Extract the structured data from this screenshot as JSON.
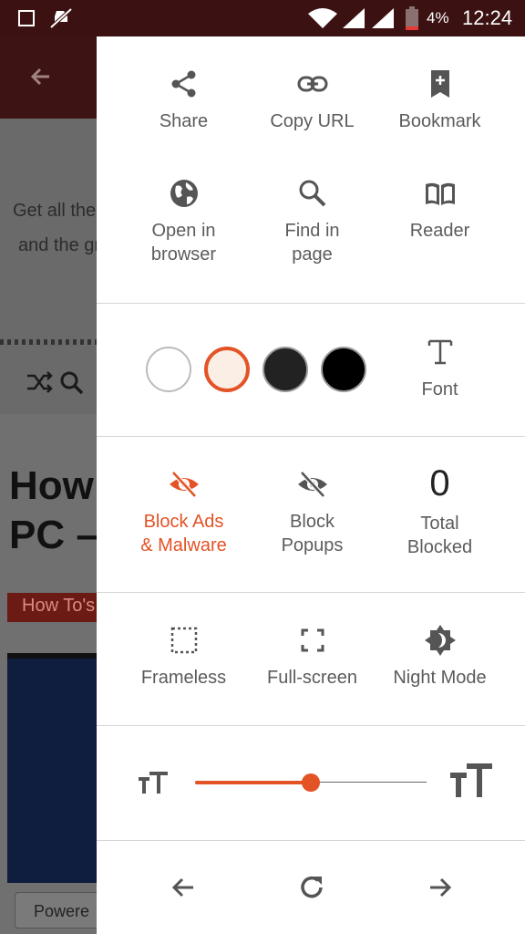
{
  "status": {
    "battery_pct": "4%",
    "time": "12:24"
  },
  "background_page": {
    "line1": "Get all the la",
    "line2": "and the gre",
    "headline1": "How T",
    "headline2": "PC –",
    "tag": "How To's",
    "powered": "Powere"
  },
  "menu": {
    "row1": [
      {
        "label": "Share",
        "icon": "share-icon"
      },
      {
        "label": "Copy URL",
        "icon": "link-icon"
      },
      {
        "label": "Bookmark",
        "icon": "bookmark-icon"
      }
    ],
    "row2": [
      {
        "label1": "Open in",
        "label2": "browser",
        "icon": "globe-icon"
      },
      {
        "label1": "Find in",
        "label2": "page",
        "icon": "search-icon"
      },
      {
        "label": "Reader",
        "icon": "book-icon"
      }
    ],
    "themes": {
      "colors": [
        "#ffffff",
        "#fbeee4",
        "#222222",
        "#000000"
      ],
      "selected": 1,
      "font_label": "Font"
    },
    "blocking": {
      "ads_1": "Block Ads",
      "ads_2": "& Malware",
      "popups_1": "Block",
      "popups_2": "Popups",
      "total_count": "0",
      "total_1": "Total",
      "total_2": "Blocked"
    },
    "modes": [
      {
        "label": "Frameless",
        "icon": "frameless-icon"
      },
      {
        "label": "Full-screen",
        "icon": "fullscreen-icon"
      },
      {
        "label": "Night Mode",
        "icon": "night-mode-icon"
      }
    ],
    "text_size": {
      "value_pct": 50
    }
  },
  "colors": {
    "accent": "#e35326"
  }
}
